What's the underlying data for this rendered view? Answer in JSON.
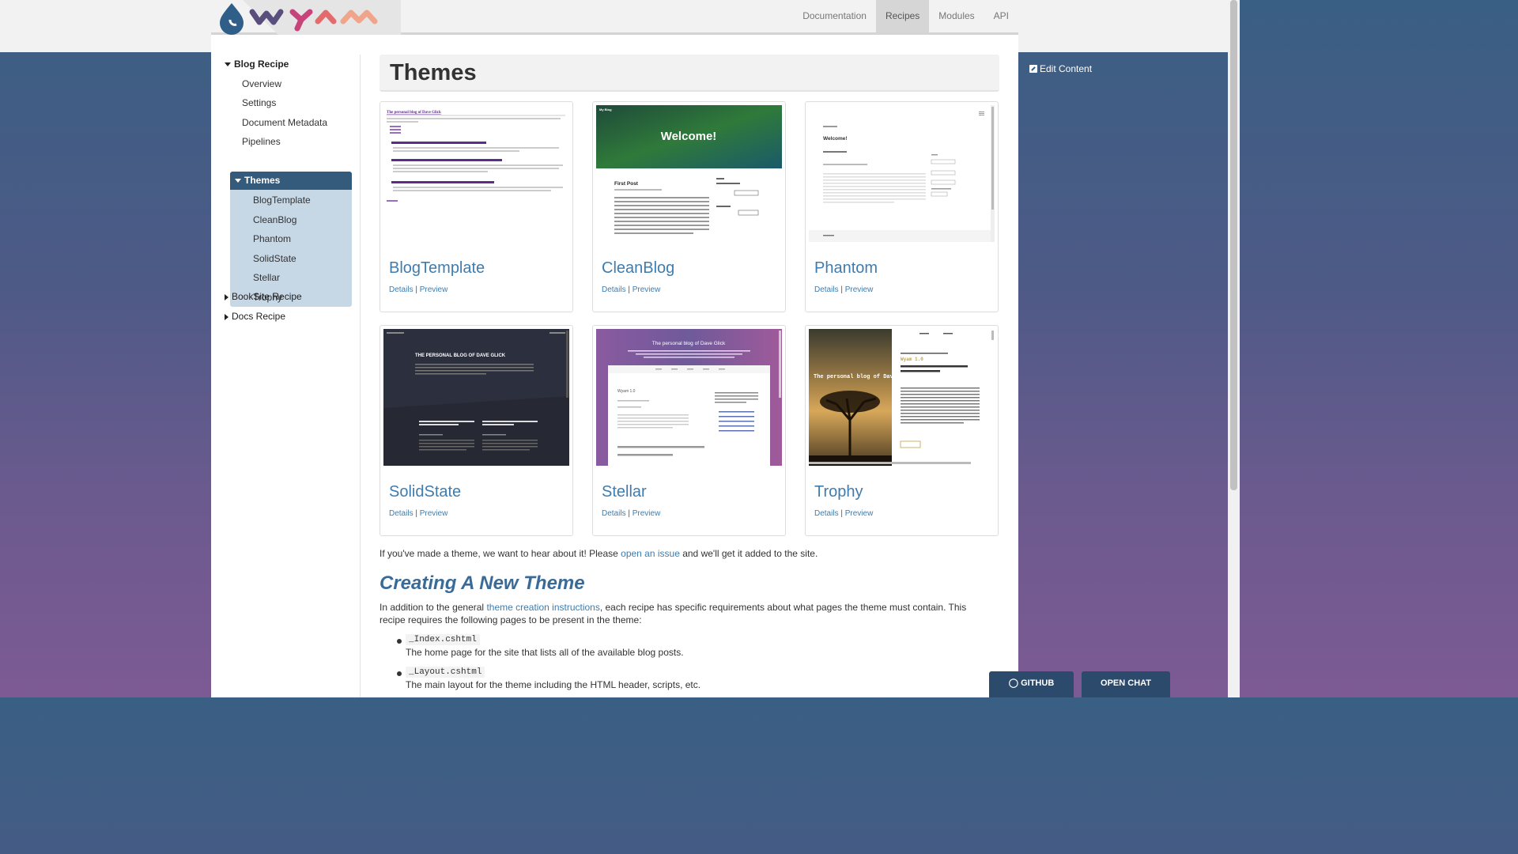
{
  "nav": {
    "items": [
      "Documentation",
      "Recipes",
      "Modules",
      "API"
    ],
    "active": "Recipes"
  },
  "sidebar": {
    "blog_recipe": "Blog Recipe",
    "items": [
      "Overview",
      "Settings",
      "Document Metadata",
      "Pipelines"
    ],
    "themes": "Themes",
    "theme_items": [
      "BlogTemplate",
      "CleanBlog",
      "Phantom",
      "SolidState",
      "Stellar",
      "Trophy"
    ],
    "booksite": "BookSite Recipe",
    "docs": "Docs Recipe"
  },
  "page": {
    "title": "Themes",
    "cards": [
      {
        "name": "BlogTemplate",
        "details": "Details",
        "sep": "|",
        "preview": "Preview"
      },
      {
        "name": "CleanBlog",
        "details": "Details",
        "sep": "|",
        "preview": "Preview"
      },
      {
        "name": "Phantom",
        "details": "Details",
        "sep": "|",
        "preview": "Preview"
      },
      {
        "name": "SolidState",
        "details": "Details",
        "sep": "|",
        "preview": "Preview"
      },
      {
        "name": "Stellar",
        "details": "Details",
        "sep": "|",
        "preview": "Preview"
      },
      {
        "name": "Trophy",
        "details": "Details",
        "sep": "|",
        "preview": "Preview"
      }
    ],
    "thumb_text": {
      "blogtemplate_title": "The personal blog of Dave Glick",
      "cleanblog_banner": "Welcome!",
      "cleanblog_my_blog": "My Blog",
      "cleanblog_post": "First Post",
      "phantom_welcome": "Welcome!",
      "solidstate_title": "THE PERSONAL BLOG OF DAVE GLICK",
      "stellar_title": "The personal blog of Dave Glick",
      "stellar_post": "Wyam 1.0",
      "trophy_title": "The personal blog of Dave Glick",
      "trophy_post": "Wyam 1.0"
    },
    "hear_pre": "If you've made a theme, we want to hear about it! Please ",
    "hear_link": "open an issue",
    "hear_post": " and we'll get it added to the site.",
    "section_title": "Creating A New Theme",
    "intro_pre": "In addition to the general ",
    "intro_link": "theme creation instructions",
    "intro_post": ", each recipe has specific requirements about what pages the theme must contain. This recipe requires the following pages to be present in the theme:",
    "files": [
      {
        "name": "_Index.cshtml",
        "desc": "The home page for the site that lists all of the available blog posts."
      },
      {
        "name": "_Layout.cshtml",
        "desc": "The main layout for the theme including the HTML header, scripts, etc."
      }
    ]
  },
  "edit_content": "Edit Content",
  "buttons": {
    "github": "GITHUB",
    "chat": "OPEN CHAT"
  },
  "colors": {
    "accent": "#3f7cae",
    "active_nav": "#355b7c",
    "sidebar_sub": "#c6d7e6"
  }
}
